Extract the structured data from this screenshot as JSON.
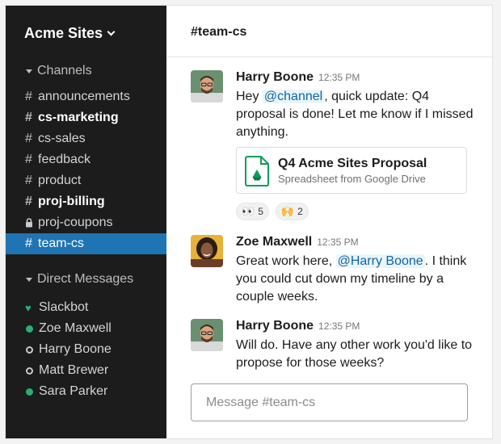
{
  "workspace": {
    "name": "Acme Sites"
  },
  "sidebar": {
    "channels_label": "Channels",
    "channels": [
      {
        "name": "announcements",
        "bold": false,
        "active": false,
        "private": false
      },
      {
        "name": "cs-marketing",
        "bold": true,
        "active": false,
        "private": false
      },
      {
        "name": "cs-sales",
        "bold": false,
        "active": false,
        "private": false
      },
      {
        "name": "feedback",
        "bold": false,
        "active": false,
        "private": false
      },
      {
        "name": "product",
        "bold": false,
        "active": false,
        "private": false
      },
      {
        "name": "proj-billing",
        "bold": true,
        "active": false,
        "private": false
      },
      {
        "name": "proj-coupons",
        "bold": false,
        "active": false,
        "private": true
      },
      {
        "name": "team-cs",
        "bold": false,
        "active": true,
        "private": false
      }
    ],
    "dm_label": "Direct Messages",
    "dms": [
      {
        "name": "Slackbot",
        "status": "bot"
      },
      {
        "name": "Zoe Maxwell",
        "status": "online"
      },
      {
        "name": "Harry Boone",
        "status": "away"
      },
      {
        "name": "Matt Brewer",
        "status": "away"
      },
      {
        "name": "Sara Parker",
        "status": "online"
      }
    ]
  },
  "header": {
    "title": "#team-cs"
  },
  "messages": [
    {
      "author": "Harry Boone",
      "time": "12:35 PM",
      "mention": "@channel",
      "text_after": ", quick update: Q4 proposal is done! Let me know if I missed anything.",
      "attachment": {
        "title": "Q4 Acme Sites Proposal",
        "subtitle": "Spreadsheet from Google Drive"
      },
      "reactions": [
        {
          "emoji": "👀",
          "count": "5"
        },
        {
          "emoji": "🙌",
          "count": "2"
        }
      ]
    },
    {
      "author": "Zoe Maxwell",
      "time": "12:35 PM",
      "text_before": "Great work here, ",
      "mention": "@Harry Boone",
      "text_after": ". I think you could cut down my timeline by a couple weeks."
    },
    {
      "author": "Harry Boone",
      "time": "12:35 PM",
      "text": "Will do. Have any other work you'd like to propose for those weeks?"
    }
  ],
  "composer": {
    "placeholder": "Message #team-cs"
  },
  "colors": {
    "sidebar_bg": "#1c1c1c",
    "active_channel": "#1f74b4",
    "online": "#2bac76",
    "mention": "#1264a3",
    "drive_green": "#0f9d58"
  }
}
